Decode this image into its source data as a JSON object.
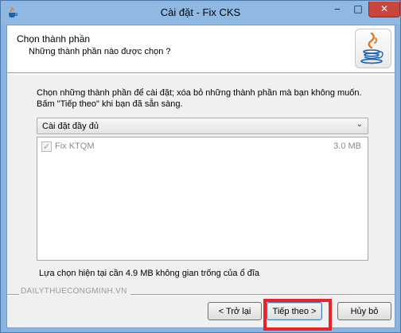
{
  "window": {
    "title": "Cài đặt - Fix CKS",
    "minimize_glyph": "‒",
    "maximize_glyph": "□",
    "close_glyph": "✕",
    "app_icon": "java-icon",
    "colors": {
      "titlebar": "#8fb9e3",
      "close": "#c9463d",
      "highlight": "#e8242a"
    }
  },
  "header": {
    "title": "Chọn thành phần",
    "subtitle": "Những thành phần nào được chọn ?"
  },
  "instructions": {
    "line1": "Chọn những thành phần để cài đặt; xóa bỏ những thành phần mà bạn không muốn.",
    "line2": "Bấm \"Tiếp theo\" khi bạn đã sẵn sàng."
  },
  "install_type": {
    "selected": "Cài đặt đầy đủ",
    "arrow_glyph": "⌄"
  },
  "components": [
    {
      "name": "Fix KTQM",
      "size": "3.0 MB",
      "checked": true,
      "disabled": true
    }
  ],
  "space_required": "Lựa chọn hiện tại cần 4.9 MB không gian trống của ổ đĩa",
  "watermark": "DAILYTHUECONGMINH.VN",
  "buttons": {
    "back": "< Trở lại",
    "next": "Tiếp theo >",
    "cancel": "Hủy bỏ"
  }
}
